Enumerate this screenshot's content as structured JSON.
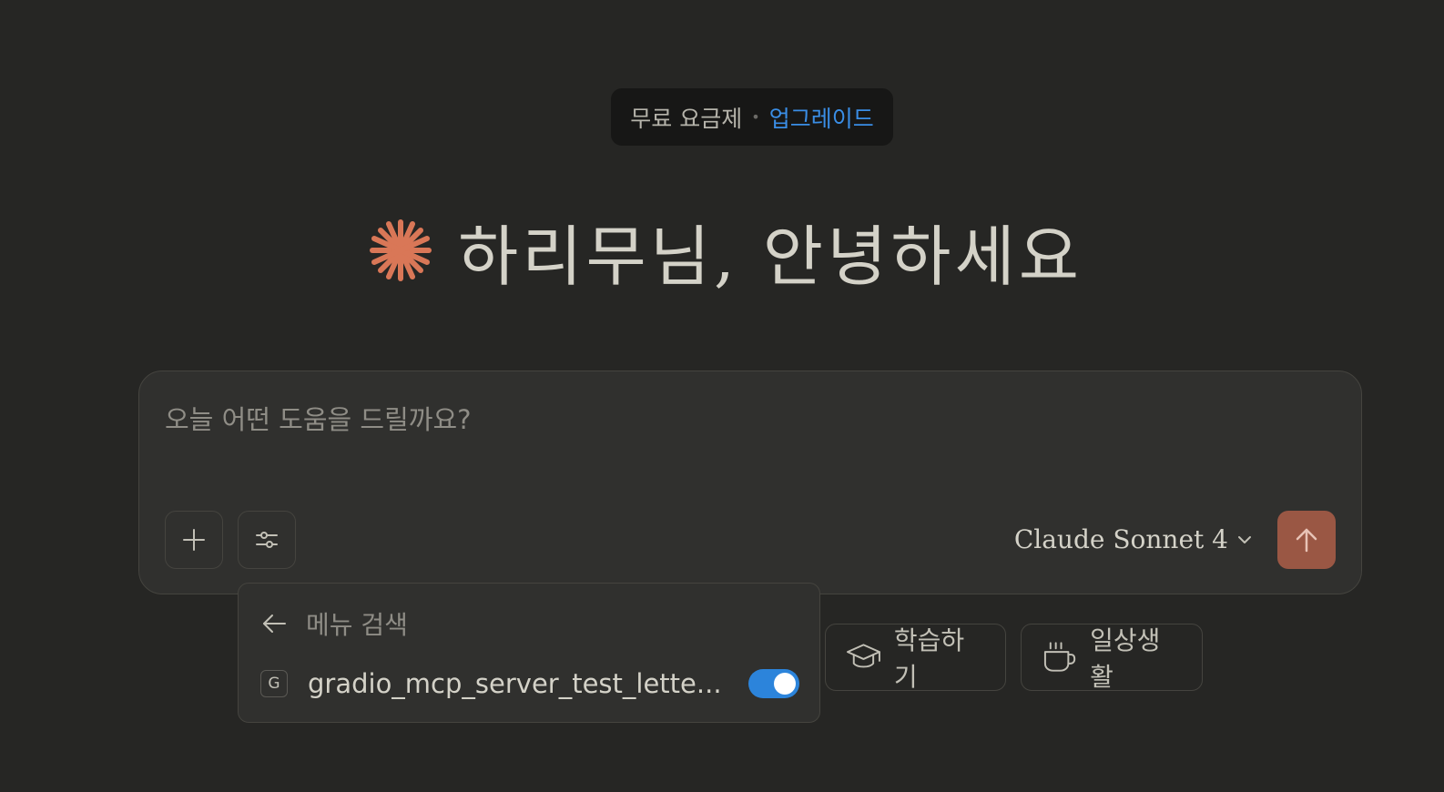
{
  "plan_banner": {
    "plan_text": "무료 요금제",
    "separator": "•",
    "upgrade_label": "업그레이드",
    "upgrade_color": "#3a8ee6"
  },
  "greeting": {
    "icon": "claude-spark-icon",
    "icon_color": "#d97757",
    "text": "하리무님, 안녕하세요"
  },
  "composer": {
    "placeholder": "오늘 어떤 도움을 드릴까요?",
    "add_icon": "plus-icon",
    "tools_icon": "sliders-icon",
    "model_label": "Claude Sonnet 4",
    "model_icon": "chevron-down-icon",
    "send_icon": "arrow-up-icon",
    "send_color": "#9a5744"
  },
  "menu": {
    "back_icon": "arrow-left-icon",
    "search_label": "메뉴 검색",
    "items": [
      {
        "badge": "G",
        "label": "gradio_mcp_server_test_lette...",
        "enabled": true
      }
    ],
    "toggle_color": "#2c84db"
  },
  "chips": [
    {
      "icon": "graduation-cap-icon",
      "label": "학습하기"
    },
    {
      "icon": "coffee-cup-icon",
      "label": "일상생활"
    }
  ]
}
